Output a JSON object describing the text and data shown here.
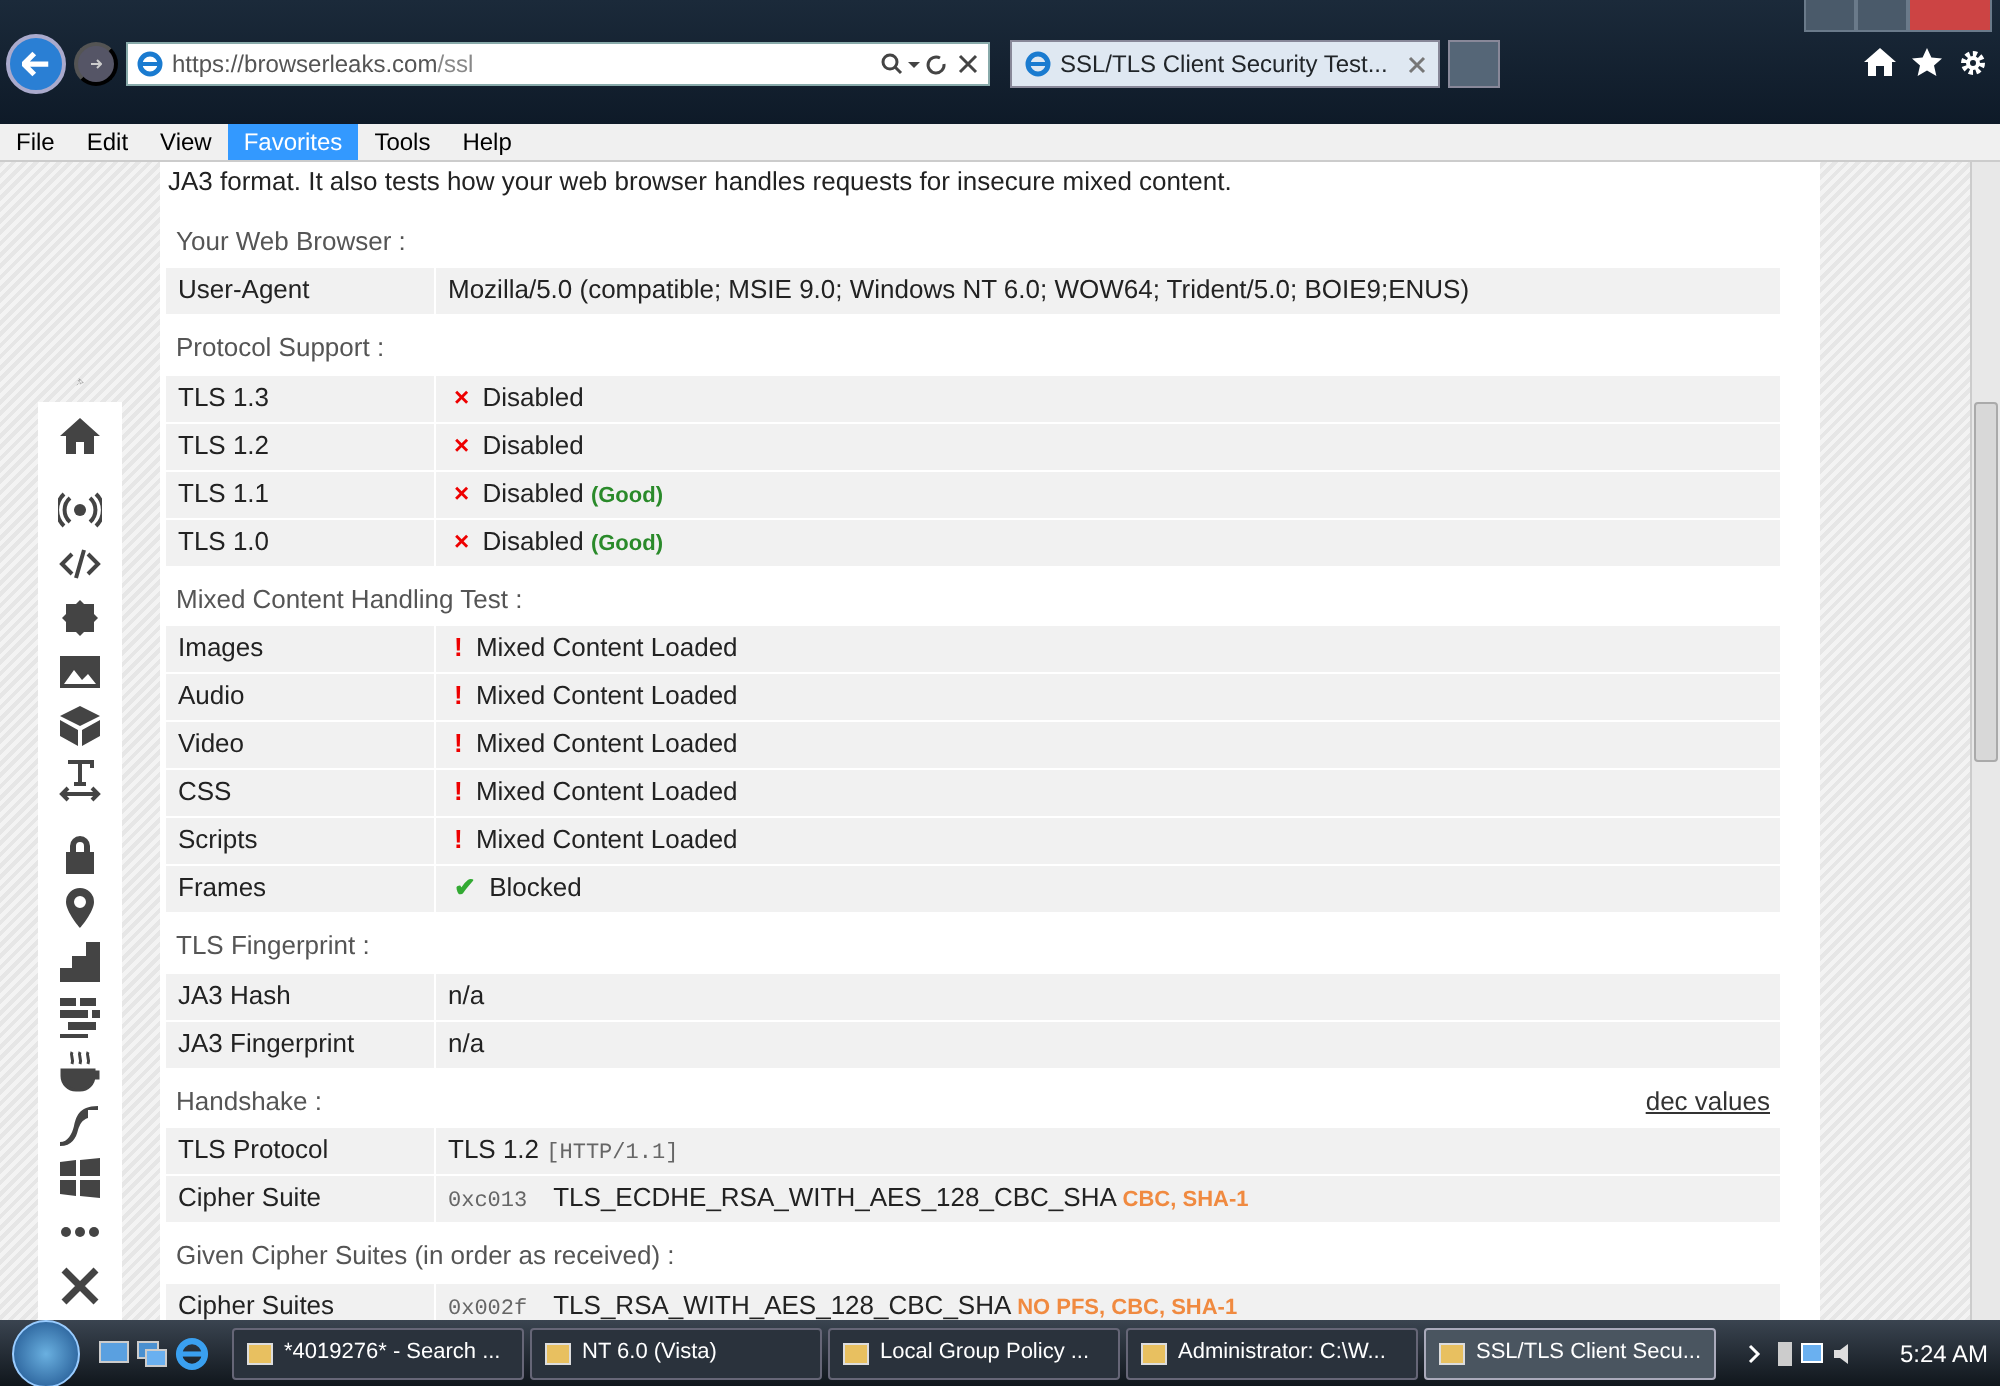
{
  "browser": {
    "url_host": "https://browserleaks.com",
    "url_path": "/ssl",
    "tab_title": "SSL/TLS Client Security Test...",
    "menu": [
      {
        "label": "File",
        "selected": false
      },
      {
        "label": "Edit",
        "selected": false
      },
      {
        "label": "View",
        "selected": false
      },
      {
        "label": "Favorites",
        "selected": true
      },
      {
        "label": "Tools",
        "selected": false
      },
      {
        "label": "Help",
        "selected": false
      }
    ]
  },
  "intro": "JA3 format. It also tests how your web browser handles requests for insecure mixed content.",
  "sections": [
    {
      "title": "Your Web Browser :",
      "rows": [
        {
          "kind": "text",
          "label": "User-Agent",
          "value": "Mozilla/5.0 (compatible; MSIE 9.0; Windows NT 6.0; WOW64; Trident/5.0; BOIE9;ENUS)"
        }
      ]
    },
    {
      "title": "Protocol Support :",
      "rows": [
        {
          "kind": "status",
          "label": "TLS 1.3",
          "mark": "×",
          "color": "#ee0000",
          "value": "Disabled"
        },
        {
          "kind": "status",
          "label": "TLS 1.2",
          "mark": "×",
          "color": "#ee0000",
          "value": "Disabled"
        },
        {
          "kind": "status",
          "label": "TLS 1.1",
          "mark": "×",
          "color": "#ee0000",
          "value": "Disabled",
          "note": {
            "text": "(Good)",
            "color": "#2a8a2a"
          }
        },
        {
          "kind": "status",
          "label": "TLS 1.0",
          "mark": "×",
          "color": "#ee0000",
          "value": "Disabled",
          "note": {
            "text": "(Good)",
            "color": "#2a8a2a"
          }
        }
      ]
    },
    {
      "title": "Mixed Content Handling Test :",
      "rows": [
        {
          "kind": "status",
          "label": "Images",
          "mark": "!",
          "color": "#ee0000",
          "value": "Mixed Content Loaded"
        },
        {
          "kind": "status",
          "label": "Audio",
          "mark": "!",
          "color": "#ee0000",
          "value": "Mixed Content Loaded"
        },
        {
          "kind": "status",
          "label": "Video",
          "mark": "!",
          "color": "#ee0000",
          "value": "Mixed Content Loaded"
        },
        {
          "kind": "status",
          "label": "CSS",
          "mark": "!",
          "color": "#ee0000",
          "value": "Mixed Content Loaded"
        },
        {
          "kind": "status",
          "label": "Scripts",
          "mark": "!",
          "color": "#ee0000",
          "value": "Mixed Content Loaded"
        },
        {
          "kind": "status",
          "label": "Frames",
          "mark": "✔",
          "color": "#33aa33",
          "value": "Blocked"
        }
      ]
    },
    {
      "title": "TLS Fingerprint :",
      "rows": [
        {
          "kind": "text",
          "label": "JA3 Hash",
          "value": "n/a"
        },
        {
          "kind": "text",
          "label": "JA3 Fingerprint",
          "value": "n/a"
        }
      ]
    },
    {
      "title": "Handshake :",
      "link": "dec values",
      "rows": [
        {
          "kind": "code",
          "label": "TLS Protocol",
          "value": "TLS 1.2",
          "code": "[HTTP/1.1]"
        },
        {
          "kind": "code",
          "label": "Cipher Suite",
          "prefix": "0xc013",
          "value": "TLS_ECDHE_RSA_WITH_AES_128_CBC_SHA",
          "note": {
            "text": "CBC, SHA-1",
            "color": "#f08a40"
          }
        }
      ]
    },
    {
      "title": "Given Cipher Suites (in order as received) :",
      "rows": [
        {
          "kind": "code",
          "label": "Cipher Suites",
          "prefix": "0x002f",
          "value": "TLS_RSA_WITH_AES_128_CBC_SHA",
          "note": {
            "text": "NO PFS, CBC, SHA-1",
            "color": "#f08a40"
          }
        }
      ]
    }
  ],
  "taskbar": {
    "items": [
      {
        "label": "*4019276* - Search ...",
        "selected": false
      },
      {
        "label": "NT 6.0 (Vista)",
        "selected": false
      },
      {
        "label": "Local Group Policy ...",
        "selected": false
      },
      {
        "label": "Administrator: C:\\W...",
        "selected": false
      },
      {
        "label": "SSL/TLS Client Secu...",
        "selected": true
      }
    ],
    "clock": "5:24 AM"
  }
}
